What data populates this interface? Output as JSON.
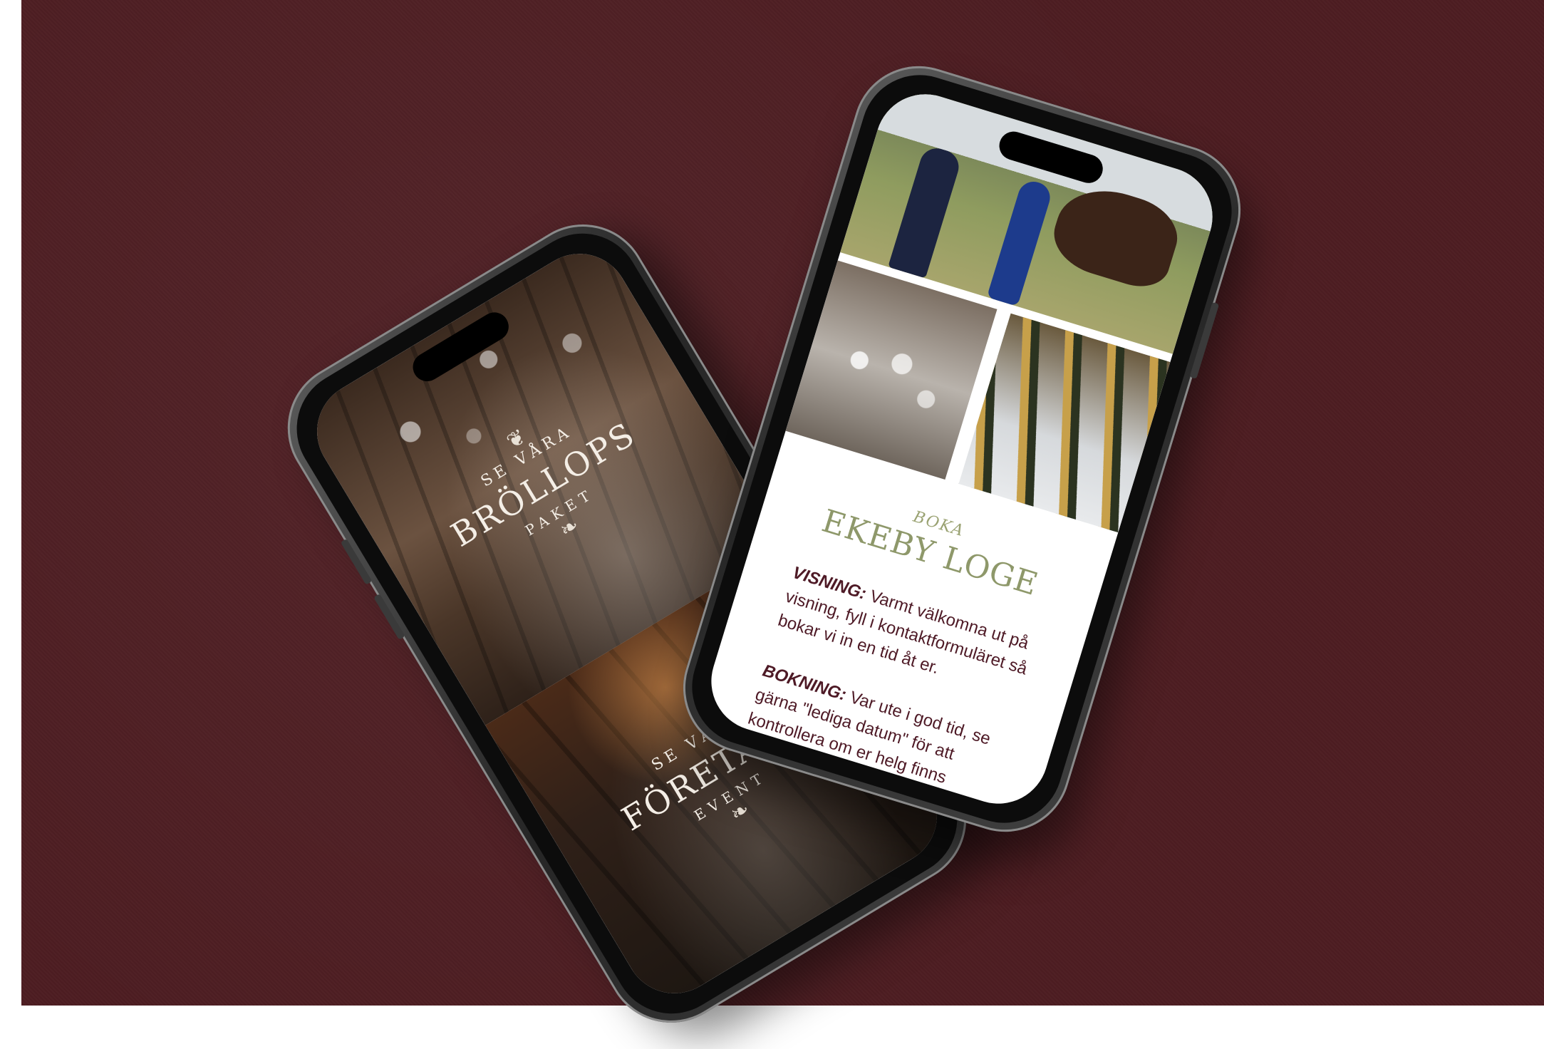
{
  "scene": {
    "background_color": "#4d1d22"
  },
  "left_phone": {
    "sections": [
      {
        "kicker": "SE VÅRA",
        "title": "BRÖLLOPS",
        "subtitle": "PAKET"
      },
      {
        "kicker": "SE VÅRA",
        "title": "FÖRETAGS",
        "subtitle": "EVENT"
      }
    ]
  },
  "right_phone": {
    "booking": {
      "kicker": "BOKA",
      "title": "EKEBY LOGE",
      "blocks": [
        {
          "lead": "VISNING:",
          "text": "Varmt välkomna ut på visning, fyll i kontaktformuläret så bokar vi in en tid åt er."
        },
        {
          "lead": "BOKNING:",
          "text": "Var ute i god tid, se gärna \"lediga datum\" för att kontrollera om er helg finns tillgänglig."
        }
      ]
    },
    "accent_colors": {
      "heading": "#8e986a",
      "body": "#4e1a26"
    }
  }
}
